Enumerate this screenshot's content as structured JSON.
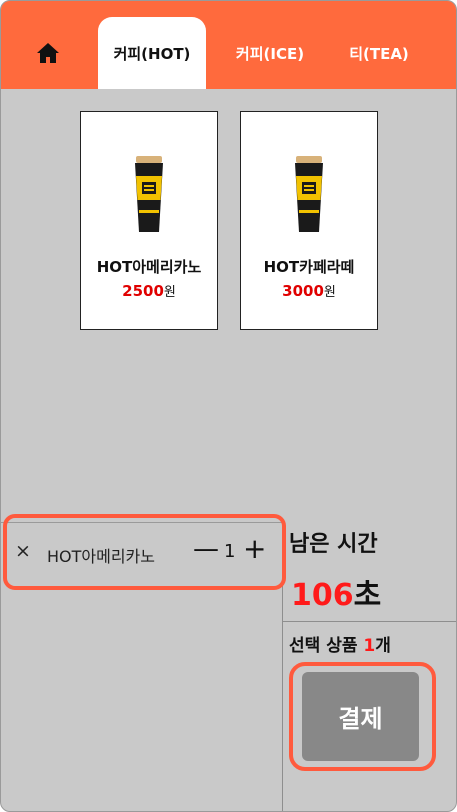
{
  "tabs": [
    {
      "label": "커피(HOT)",
      "active": true
    },
    {
      "label": "커피(ICE)",
      "active": false
    },
    {
      "label": "티(TEA)",
      "active": false
    }
  ],
  "products": [
    {
      "name": "HOT아메리카노",
      "price": "2500",
      "currency": "원",
      "cup_label": "MEGA COFFEE"
    },
    {
      "name": "HOT카페라떼",
      "price": "3000",
      "currency": "원",
      "cup_label": "MEGA COFFEE"
    }
  ],
  "cart": {
    "items": [
      {
        "remove": "×",
        "name": "HOT아메리카노",
        "minus": "—",
        "qty": "1",
        "plus": "+"
      }
    ]
  },
  "timer": {
    "label": "남은 시간",
    "value": "106",
    "unit": "초"
  },
  "selection": {
    "prefix": "선택 상품 ",
    "count": "1",
    "suffix": "개"
  },
  "pay_button": "결제",
  "colors": {
    "accent": "#ff6a3d",
    "highlight_border": "#ff5a3d",
    "price_red": "#e00000",
    "panel_bg": "#c9c9c9",
    "pay_button_bg": "#888888"
  },
  "icons": {
    "home": "home-icon",
    "remove": "close-icon",
    "decrease": "minus-icon",
    "increase": "plus-icon"
  }
}
